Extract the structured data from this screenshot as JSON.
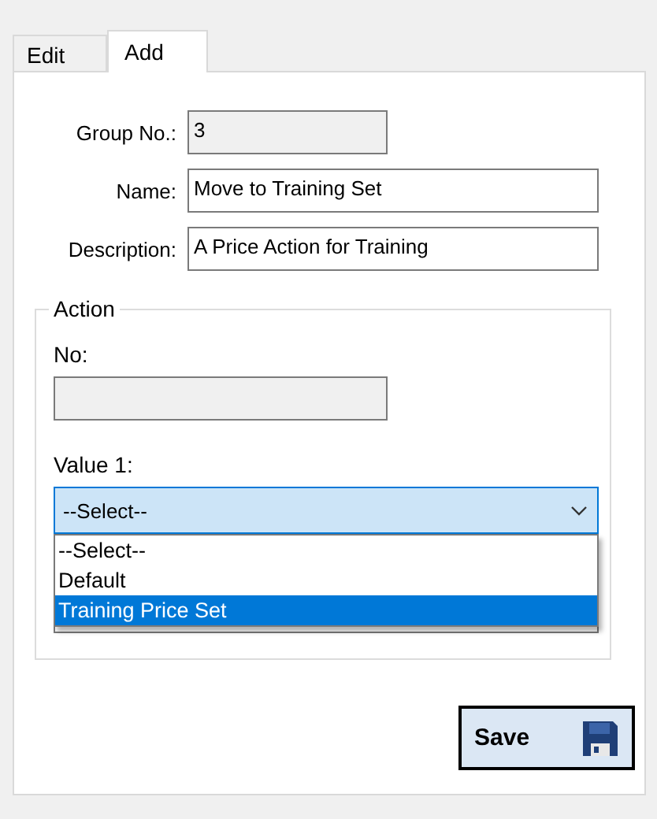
{
  "tabs": [
    {
      "label": "Edit",
      "selected": false
    },
    {
      "label": "Add",
      "selected": true
    }
  ],
  "fields": [
    {
      "label": "Group No.:",
      "value": "3",
      "disabled": true,
      "wide": false
    },
    {
      "label": "Name:",
      "value": "Move to Training Set",
      "disabled": false,
      "wide": true
    },
    {
      "label": "Description:",
      "value": "A Price Action for Training",
      "disabled": false,
      "wide": true
    }
  ],
  "action": {
    "title": "Action",
    "no_label": "No:",
    "value1_label": "Value 1:",
    "dropdown_value": "--Select--",
    "options": [
      {
        "label": "--Select--",
        "selected": false
      },
      {
        "label": "Default",
        "selected": false
      },
      {
        "label": "Training Price Set",
        "selected": true
      }
    ]
  },
  "save_button": "Save"
}
